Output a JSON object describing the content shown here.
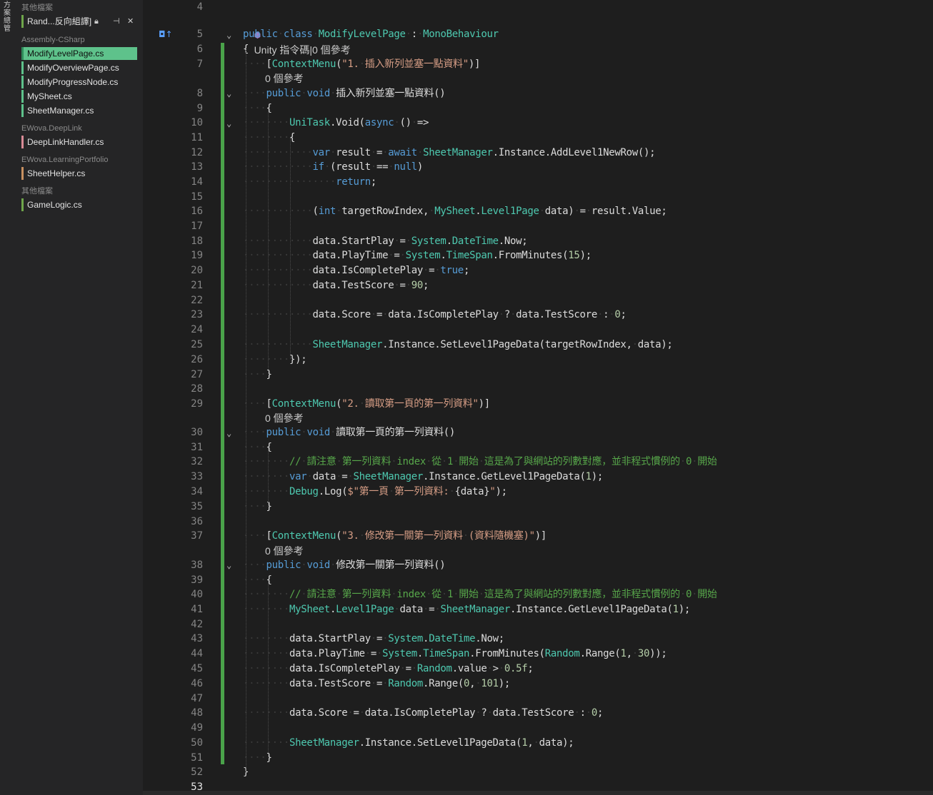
{
  "left_strip": {
    "label": "方案總管"
  },
  "tab_panel": {
    "groups": [
      {
        "title": "其他檔案",
        "tabs": [
          {
            "label": "Rand...反向組譯]",
            "color": "#6fa64a",
            "pinned": true
          }
        ]
      },
      {
        "title": "Assembly-CSharp",
        "tabs": [
          {
            "label": "ModifyLevelPage.cs",
            "color": "#5ec28b",
            "active": true
          },
          {
            "label": "ModifyOverviewPage.cs",
            "color": "#5ec28b"
          },
          {
            "label": "ModifyProgressNode.cs",
            "color": "#5ec28b"
          },
          {
            "label": "MySheet.cs",
            "color": "#5ec28b"
          },
          {
            "label": "SheetManager.cs",
            "color": "#5ec28b"
          }
        ]
      },
      {
        "title": "EWova.DeepLink",
        "tabs": [
          {
            "label": "DeepLinkHandler.cs",
            "color": "#d98b96"
          }
        ]
      },
      {
        "title": "EWova.LearningPortfolio",
        "tabs": [
          {
            "label": "SheetHelper.cs",
            "color": "#c89060"
          }
        ]
      },
      {
        "title": "其他檔案",
        "tabs": [
          {
            "label": "GameLogic.cs",
            "color": "#6fa64a"
          }
        ]
      }
    ],
    "icons": {
      "lock": "lock-icon",
      "pin": "pin-icon",
      "close": "close-icon"
    }
  },
  "editor": {
    "codelens": {
      "class": "Unity 指令碼|0 個參考",
      "ref0": "0 個參考"
    },
    "line_numbers": [
      "4",
      "5",
      "6",
      "7",
      "8",
      "9",
      "10",
      "11",
      "12",
      "13",
      "14",
      "15",
      "16",
      "17",
      "18",
      "19",
      "20",
      "21",
      "22",
      "23",
      "24",
      "25",
      "26",
      "27",
      "28",
      "29",
      "30",
      "31",
      "32",
      "33",
      "34",
      "35",
      "36",
      "37",
      "38",
      "39",
      "40",
      "41",
      "42",
      "43",
      "44",
      "45",
      "46",
      "47",
      "48",
      "49",
      "50",
      "51",
      "52",
      "53"
    ],
    "current_line": "53",
    "code_lines": [
      {
        "ln": "4",
        "tokens": []
      },
      {
        "ln": "5",
        "tokens": [
          [
            "kw",
            "public"
          ],
          [
            "",
            "·"
          ],
          [
            "kw",
            "class"
          ],
          [
            "",
            "·"
          ],
          [
            "ty",
            "ModifyLevelPage"
          ],
          [
            "",
            "·:·"
          ],
          [
            "ty",
            "MonoBehaviour"
          ]
        ]
      },
      {
        "ln": "6",
        "tokens": [
          [
            "",
            "{"
          ]
        ]
      },
      {
        "ln": "7",
        "tokens": [
          [
            "",
            "····["
          ],
          [
            "ty",
            "ContextMenu"
          ],
          [
            "",
            "("
          ],
          [
            "st",
            "\"1.·插入新列並塞一點資料\""
          ],
          [
            "",
            ")]"
          ]
        ]
      },
      {
        "ln": "8",
        "tokens": [
          [
            "",
            "····"
          ],
          [
            "kw",
            "public"
          ],
          [
            "",
            "·"
          ],
          [
            "kw",
            "void"
          ],
          [
            "",
            "·插入新列並塞一點資料()"
          ]
        ]
      },
      {
        "ln": "9",
        "tokens": [
          [
            "",
            "····{"
          ]
        ]
      },
      {
        "ln": "10",
        "tokens": [
          [
            "",
            "········"
          ],
          [
            "ty",
            "UniTask"
          ],
          [
            "",
            ".Void("
          ],
          [
            "kw",
            "async"
          ],
          [
            "",
            "·()·=>"
          ]
        ]
      },
      {
        "ln": "11",
        "tokens": [
          [
            "",
            "········{"
          ]
        ]
      },
      {
        "ln": "12",
        "tokens": [
          [
            "",
            "············"
          ],
          [
            "kw",
            "var"
          ],
          [
            "",
            "·result·=·"
          ],
          [
            "kw",
            "await"
          ],
          [
            "",
            "·"
          ],
          [
            "ty",
            "SheetManager"
          ],
          [
            "",
            ".Instance.AddLevel1NewRow();"
          ]
        ]
      },
      {
        "ln": "13",
        "tokens": [
          [
            "",
            "············"
          ],
          [
            "kw",
            "if"
          ],
          [
            "",
            "·(result·==·"
          ],
          [
            "kw",
            "null"
          ],
          [
            "",
            ")"
          ]
        ]
      },
      {
        "ln": "14",
        "tokens": [
          [
            "",
            "················"
          ],
          [
            "kw",
            "return"
          ],
          [
            "",
            ";"
          ]
        ]
      },
      {
        "ln": "15",
        "tokens": []
      },
      {
        "ln": "16",
        "tokens": [
          [
            "",
            "············("
          ],
          [
            "kw",
            "int"
          ],
          [
            "",
            "·targetRowIndex,·"
          ],
          [
            "ty",
            "MySheet"
          ],
          [
            "",
            "."
          ],
          [
            "ty",
            "Level1Page"
          ],
          [
            "",
            "·data)·=·result.Value;"
          ]
        ]
      },
      {
        "ln": "17",
        "tokens": []
      },
      {
        "ln": "18",
        "tokens": [
          [
            "",
            "············data.StartPlay·=·"
          ],
          [
            "ty",
            "System"
          ],
          [
            "",
            "."
          ],
          [
            "ty",
            "DateTime"
          ],
          [
            "",
            ".Now;"
          ]
        ]
      },
      {
        "ln": "19",
        "tokens": [
          [
            "",
            "············data.PlayTime·=·"
          ],
          [
            "ty",
            "System"
          ],
          [
            "",
            "."
          ],
          [
            "ty",
            "TimeSpan"
          ],
          [
            "",
            ".FromMinutes("
          ],
          [
            "nu",
            "15"
          ],
          [
            "",
            ");"
          ]
        ]
      },
      {
        "ln": "20",
        "tokens": [
          [
            "",
            "············data.IsCompletePlay·=·"
          ],
          [
            "kw",
            "true"
          ],
          [
            "",
            ";"
          ]
        ]
      },
      {
        "ln": "21",
        "tokens": [
          [
            "",
            "············data.TestScore·=·"
          ],
          [
            "nu",
            "90"
          ],
          [
            "",
            ";"
          ]
        ]
      },
      {
        "ln": "22",
        "tokens": []
      },
      {
        "ln": "23",
        "tokens": [
          [
            "",
            "············data.Score·=·data.IsCompletePlay·?·data.TestScore·:·"
          ],
          [
            "nu",
            "0"
          ],
          [
            "",
            ";"
          ]
        ]
      },
      {
        "ln": "24",
        "tokens": []
      },
      {
        "ln": "25",
        "tokens": [
          [
            "",
            "············"
          ],
          [
            "ty",
            "SheetManager"
          ],
          [
            "",
            ".Instance.SetLevel1PageData(targetRowIndex,·data);"
          ]
        ]
      },
      {
        "ln": "26",
        "tokens": [
          [
            "",
            "········});"
          ]
        ]
      },
      {
        "ln": "27",
        "tokens": [
          [
            "",
            "····}"
          ]
        ]
      },
      {
        "ln": "28",
        "tokens": []
      },
      {
        "ln": "29",
        "tokens": [
          [
            "",
            "····["
          ],
          [
            "ty",
            "ContextMenu"
          ],
          [
            "",
            "("
          ],
          [
            "st",
            "\"2.·讀取第一頁的第一列資料\""
          ],
          [
            "",
            ")]"
          ]
        ]
      },
      {
        "ln": "30",
        "tokens": [
          [
            "",
            "····"
          ],
          [
            "kw",
            "public"
          ],
          [
            "",
            "·"
          ],
          [
            "kw",
            "void"
          ],
          [
            "",
            "·讀取第一頁的第一列資料()"
          ]
        ]
      },
      {
        "ln": "31",
        "tokens": [
          [
            "",
            "····{"
          ]
        ]
      },
      {
        "ln": "32",
        "tokens": [
          [
            "",
            "········"
          ],
          [
            "cm",
            "//·請注意·第一列資料·index·從·1·開始·這是為了與網站的列數對應，並非程式慣例的·0·開始"
          ]
        ]
      },
      {
        "ln": "33",
        "tokens": [
          [
            "",
            "········"
          ],
          [
            "kw",
            "var"
          ],
          [
            "",
            "·data·=·"
          ],
          [
            "ty",
            "SheetManager"
          ],
          [
            "",
            ".Instance.GetLevel1PageData("
          ],
          [
            "nu",
            "1"
          ],
          [
            "",
            ");"
          ]
        ]
      },
      {
        "ln": "34",
        "tokens": [
          [
            "",
            "········"
          ],
          [
            "ty",
            "Debug"
          ],
          [
            "",
            ".Log("
          ],
          [
            "st",
            "$\"第一頁·第一列資料:·"
          ],
          [
            "",
            "{data}"
          ],
          [
            "st",
            "\""
          ],
          [
            "",
            ");"
          ]
        ]
      },
      {
        "ln": "35",
        "tokens": [
          [
            "",
            "····}"
          ]
        ]
      },
      {
        "ln": "36",
        "tokens": []
      },
      {
        "ln": "37",
        "tokens": [
          [
            "",
            "····["
          ],
          [
            "ty",
            "ContextMenu"
          ],
          [
            "",
            "("
          ],
          [
            "st",
            "\"3.·修改第一關第一列資料·(資料隨機塞)\""
          ],
          [
            "",
            ")]"
          ]
        ]
      },
      {
        "ln": "38",
        "tokens": [
          [
            "",
            "····"
          ],
          [
            "kw",
            "public"
          ],
          [
            "",
            "·"
          ],
          [
            "kw",
            "void"
          ],
          [
            "",
            "·修改第一關第一列資料()"
          ]
        ]
      },
      {
        "ln": "39",
        "tokens": [
          [
            "",
            "····{"
          ]
        ]
      },
      {
        "ln": "40",
        "tokens": [
          [
            "",
            "········"
          ],
          [
            "cm",
            "//·請注意·第一列資料·index·從·1·開始·這是為了與網站的列數對應，並非程式慣例的·0·開始"
          ]
        ]
      },
      {
        "ln": "41",
        "tokens": [
          [
            "",
            "········"
          ],
          [
            "ty",
            "MySheet"
          ],
          [
            "",
            "."
          ],
          [
            "ty",
            "Level1Page"
          ],
          [
            "",
            "·data·=·"
          ],
          [
            "ty",
            "SheetManager"
          ],
          [
            "",
            ".Instance.GetLevel1PageData("
          ],
          [
            "nu",
            "1"
          ],
          [
            "",
            ");"
          ]
        ]
      },
      {
        "ln": "42",
        "tokens": []
      },
      {
        "ln": "43",
        "tokens": [
          [
            "",
            "········data.StartPlay·=·"
          ],
          [
            "ty",
            "System"
          ],
          [
            "",
            "."
          ],
          [
            "ty",
            "DateTime"
          ],
          [
            "",
            ".Now;"
          ]
        ]
      },
      {
        "ln": "44",
        "tokens": [
          [
            "",
            "········data.PlayTime·=·"
          ],
          [
            "ty",
            "System"
          ],
          [
            "",
            "."
          ],
          [
            "ty",
            "TimeSpan"
          ],
          [
            "",
            ".FromMinutes("
          ],
          [
            "ty",
            "Random"
          ],
          [
            "",
            ".Range("
          ],
          [
            "nu",
            "1"
          ],
          [
            "",
            ",·"
          ],
          [
            "nu",
            "30"
          ],
          [
            "",
            "));"
          ]
        ]
      },
      {
        "ln": "45",
        "tokens": [
          [
            "",
            "········data.IsCompletePlay·=·"
          ],
          [
            "ty",
            "Random"
          ],
          [
            "",
            ".value·>·"
          ],
          [
            "nu",
            "0.5f"
          ],
          [
            "",
            ";"
          ]
        ]
      },
      {
        "ln": "46",
        "tokens": [
          [
            "",
            "········data.TestScore·=·"
          ],
          [
            "ty",
            "Random"
          ],
          [
            "",
            ".Range("
          ],
          [
            "nu",
            "0"
          ],
          [
            "",
            ",·"
          ],
          [
            "nu",
            "101"
          ],
          [
            "",
            ");"
          ]
        ]
      },
      {
        "ln": "47",
        "tokens": []
      },
      {
        "ln": "48",
        "tokens": [
          [
            "",
            "········data.Score·=·data.IsCompletePlay·?·data.TestScore·:·"
          ],
          [
            "nu",
            "0"
          ],
          [
            "",
            ";"
          ]
        ]
      },
      {
        "ln": "49",
        "tokens": []
      },
      {
        "ln": "50",
        "tokens": [
          [
            "",
            "········"
          ],
          [
            "ty",
            "SheetManager"
          ],
          [
            "",
            ".Instance.SetLevel1PageData("
          ],
          [
            "nu",
            "1"
          ],
          [
            "",
            ",·data);"
          ]
        ]
      },
      {
        "ln": "51",
        "tokens": [
          [
            "",
            "····}"
          ]
        ]
      },
      {
        "ln": "52",
        "tokens": [
          [
            "",
            "}"
          ]
        ]
      },
      {
        "ln": "53",
        "tokens": []
      }
    ]
  }
}
